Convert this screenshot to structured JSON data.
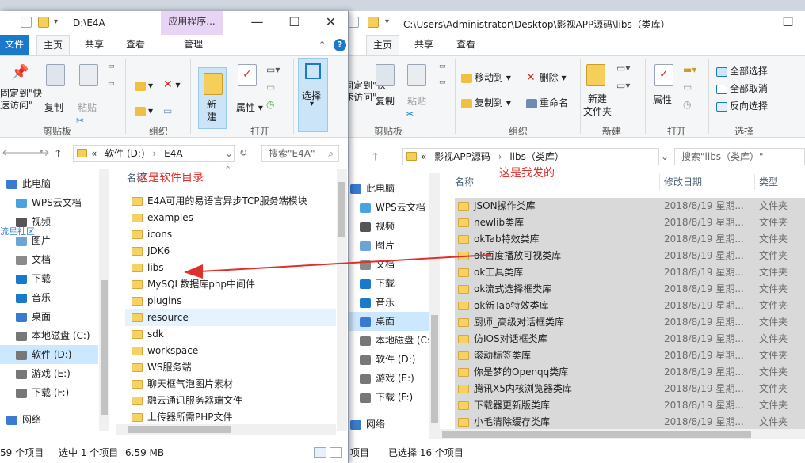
{
  "annotations": {
    "left": "这是软件目录",
    "right": "这是我发的"
  },
  "watermark": "流星社区",
  "left_window": {
    "title": "D:\\E4A",
    "context_tab": "应用程序...",
    "tabs": [
      "文件",
      "主页",
      "共享",
      "查看",
      "管理"
    ],
    "ribbon": {
      "pin_label": "固定到\"快\n速访问\"",
      "copy": "复制",
      "paste": "粘贴",
      "new": "新\n建",
      "properties": "属性",
      "select": "选择",
      "groups": [
        "剪贴板",
        "组织",
        "打开"
      ]
    },
    "address": {
      "chevron": "«",
      "crumbs": [
        "软件 (D:)",
        "E4A"
      ],
      "search_placeholder": "搜索\"E4A\""
    },
    "nav": [
      "此电脑",
      "WPS云文档",
      "视频",
      "图片",
      "文档",
      "下载",
      "音乐",
      "桌面",
      "本地磁盘 (C:)",
      "软件 (D:)",
      "游戏 (E:)",
      "下载 (F:)",
      "网络"
    ],
    "nav_selected": 9,
    "list_header": "名称",
    "files": [
      "E4A可用的易语言异步TCP服务端模块",
      "examples",
      "icons",
      "JDK6",
      "libs",
      "MySQL数据库php中间件",
      "plugins",
      "resource",
      "sdk",
      "workspace",
      "WS服务端",
      "聊天框气泡图片素材",
      "融云通讯服务器端文件",
      "上传器所需PHP文件"
    ],
    "hover_index": 7,
    "status": {
      "count": "59 个项目",
      "selected": "选中 1 个项目",
      "size": "6.59 MB"
    }
  },
  "right_window": {
    "title": "C:\\Users\\Administrator\\Desktop\\影视APP源码\\libs（类库）",
    "tabs": [
      "主页",
      "共享",
      "查看"
    ],
    "ribbon": {
      "pin_label": "固定到\"快\n速访问\"",
      "copy": "复制",
      "paste": "粘贴",
      "move_to": "移动到",
      "copy_to": "复制到",
      "delete": "删除",
      "rename": "重命名",
      "new_folder": "新建\n文件夹",
      "properties": "属性",
      "select_all": "全部选择",
      "select_none": "全部取消",
      "invert": "反向选择",
      "groups": [
        "剪贴板",
        "组织",
        "新建",
        "打开",
        "选择"
      ]
    },
    "address": {
      "chevron": "«",
      "crumbs": [
        "影视APP源码",
        "libs（类库）"
      ],
      "search_placeholder": "搜索\"libs（类库）\""
    },
    "nav": [
      "此电脑",
      "WPS云文档",
      "视频",
      "图片",
      "文档",
      "下载",
      "音乐",
      "桌面",
      "本地磁盘 (C:)",
      "软件 (D:)",
      "游戏 (E:)",
      "下载 (F:)",
      "网络"
    ],
    "nav_selected": 7,
    "columns": [
      "名称",
      "修改日期",
      "类型"
    ],
    "files": [
      {
        "name": "JSON操作类库",
        "date": "2018/8/19 星期...",
        "type": "文件夹"
      },
      {
        "name": "newlib类库",
        "date": "2018/8/19 星期...",
        "type": "文件夹"
      },
      {
        "name": "okTab特效类库",
        "date": "2018/8/19 星期...",
        "type": "文件夹"
      },
      {
        "name": "ok百度播放可视类库",
        "date": "2018/8/19 星期...",
        "type": "文件夹"
      },
      {
        "name": "ok工具类库",
        "date": "2018/8/19 星期...",
        "type": "文件夹"
      },
      {
        "name": "ok流式选择框类库",
        "date": "2018/8/19 星期...",
        "type": "文件夹"
      },
      {
        "name": "ok新Tab特效类库",
        "date": "2018/8/19 星期...",
        "type": "文件夹"
      },
      {
        "name": "厨师_高级对话框类库",
        "date": "2018/8/19 星期...",
        "type": "文件夹"
      },
      {
        "name": "仿IOS对话框类库",
        "date": "2018/8/19 星期...",
        "type": "文件夹"
      },
      {
        "name": "滚动标签类库",
        "date": "2018/8/19 星期...",
        "type": "文件夹"
      },
      {
        "name": "你是梦的Openqq类库",
        "date": "2018/8/19 星期...",
        "type": "文件夹"
      },
      {
        "name": "腾讯X5内核浏览器类库",
        "date": "2018/8/19 星期...",
        "type": "文件夹"
      },
      {
        "name": "下载器更新版类库",
        "date": "2018/8/19 星期...",
        "type": "文件夹"
      },
      {
        "name": "小毛清除缓存类库",
        "date": "2018/8/19 星期...",
        "type": "文件夹"
      }
    ],
    "status": {
      "count": "项目",
      "selected": "已选择 16 个项目"
    }
  },
  "colors": {
    "accent": "#1979ca",
    "annotation": "#e0302c",
    "folder": "#f6d263"
  }
}
